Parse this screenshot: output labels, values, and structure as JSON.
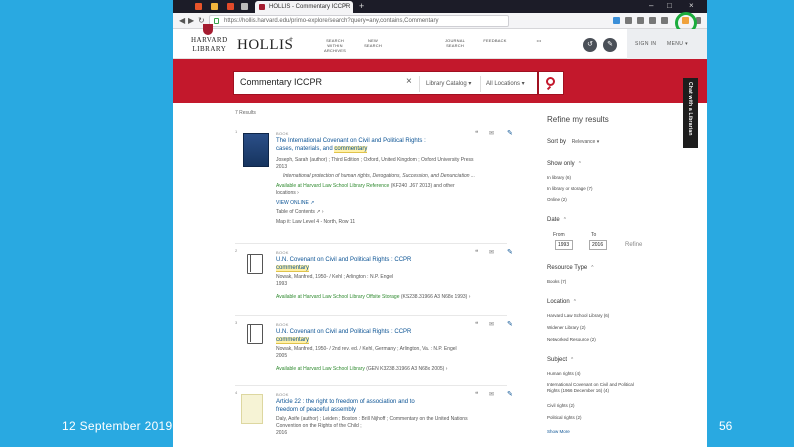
{
  "slide": {
    "date": "12 September 2019",
    "page_number": "56"
  },
  "browser": {
    "active_tab_title": "HOLLIS - Commentary ICCPR",
    "url": "https://hollis.harvard.edu/primo-explore/search?query=any,contains,Commentary",
    "new_tab": "+",
    "close_tab": "×",
    "win_min": "–",
    "win_max": "□",
    "win_close": "×"
  },
  "header": {
    "logo_top": "HARVARD",
    "logo_bottom": "LIBRARY",
    "product": "HOLLIS",
    "product_plus": "+",
    "nav": [
      {
        "line1": "SEARCH",
        "line2": "WITHIN",
        "line3": "ARCHIVES"
      },
      {
        "line1": "NEW",
        "line2": "SEARCH",
        "line3": ""
      },
      {
        "line1": "JOURNAL",
        "line2": "SEARCH",
        "line3": ""
      },
      {
        "line1": "FEEDBACK",
        "line2": "",
        "line3": ""
      },
      {
        "line1": "•••",
        "line2": "",
        "line3": ""
      }
    ],
    "signin": "SIGN IN",
    "menu": "MENU ▾"
  },
  "search": {
    "query": "Commentary ICCPR",
    "scope1": "Library Catalog ▾",
    "scope2": "All Locations ▾"
  },
  "chat_tab": "Chat with a Librarian",
  "results": {
    "count": "7 Results",
    "records": [
      {
        "num": "1",
        "type": "BOOK",
        "title_a": "The International Covenant on Civil and Political Rights :",
        "title_b": "cases, materials, and ",
        "title_hl": "commentary",
        "meta1": "Joseph, Sarah (author) ; Third Edition ; Oxford, United Kingdom ; Oxford University Press",
        "meta2": "2013",
        "meta3": "International protection of human rights, Derogations, Succession, and Denunciation ...",
        "avail_label": "Available at Harvard Law School Library Reference",
        "avail_rest": " (KF240 .J67 2013) and other",
        "avail_more": "locations ›",
        "online": "VIEW ONLINE ↗",
        "toc": "Table of Contents ↗ ›",
        "map": "Map it: Law Level 4 - North, Row 11"
      },
      {
        "num": "2",
        "type": "BOOK",
        "title_a": "U.N. Covenant on Civil and Political Rights : CCPR",
        "title_b": "",
        "title_hl": "commentary",
        "meta1": "Nowak, Manfred, 1950- / Kehl ; Arlington : N.P. Engel",
        "meta2": "1993",
        "avail_label": "Available at Harvard Law School Library Offsite Storage",
        "avail_rest": " (KS238.31966 A3 N68x 1993) ›"
      },
      {
        "num": "3",
        "type": "BOOK",
        "title_a": "U.N. Covenant on Civil and Political Rights : CCPR",
        "title_b": "",
        "title_hl": "commentary",
        "meta1": "Nowak, Manfred, 1950- / 2nd rev. ed. / Kehl, Germany ; Arlington, Va. : N.P. Engel",
        "meta2": "2005",
        "avail_label": "Available at Harvard Law School Library",
        "avail_rest": " (GEN K3238.31966 A3 N68x 2005) ›"
      },
      {
        "num": "4",
        "type": "BOOK",
        "title_a": "Article 22 : the right to freedom of association and to",
        "title_b": "freedom of peaceful assembly",
        "title_hl": "",
        "meta1": "Daly, Aoife (author) ; Leiden ; Boston : Brill Nijhoff ; Commentary on the United Nations",
        "meta2": "Convention on the Rights of the Child ;",
        "meta3": "2016"
      }
    ]
  },
  "facets": {
    "title": "Refine my results",
    "sort_label": "Sort by",
    "sort_value": "Relevance ▾",
    "show_only": "Show only",
    "show_only_items": [
      "In library (6)",
      "In library or storage (7)",
      "Online (2)"
    ],
    "date": "Date",
    "date_from_label": "From",
    "date_to_label": "To",
    "date_from": "1993",
    "date_to": "2016",
    "refine": "Refine",
    "resource_type": "Resource Type",
    "resource_items": [
      "Books (7)"
    ],
    "location": "Location",
    "location_items": [
      "Harvard Law School Library (6)",
      "Widener Library (2)",
      "Networked Resource (2)"
    ],
    "subject": "Subject",
    "subject_items": [
      "Human rights (4)",
      "International Covenant on Civil and Political",
      "Rights (1966 December 16) (4)",
      "Civil rights (2)",
      "Political rights (2)"
    ],
    "show_more": "Show More"
  },
  "colors": {
    "harvard_red": "#c3182c",
    "slide_bg": "#29a9e1",
    "highlight_ring": "#1cac3d"
  }
}
